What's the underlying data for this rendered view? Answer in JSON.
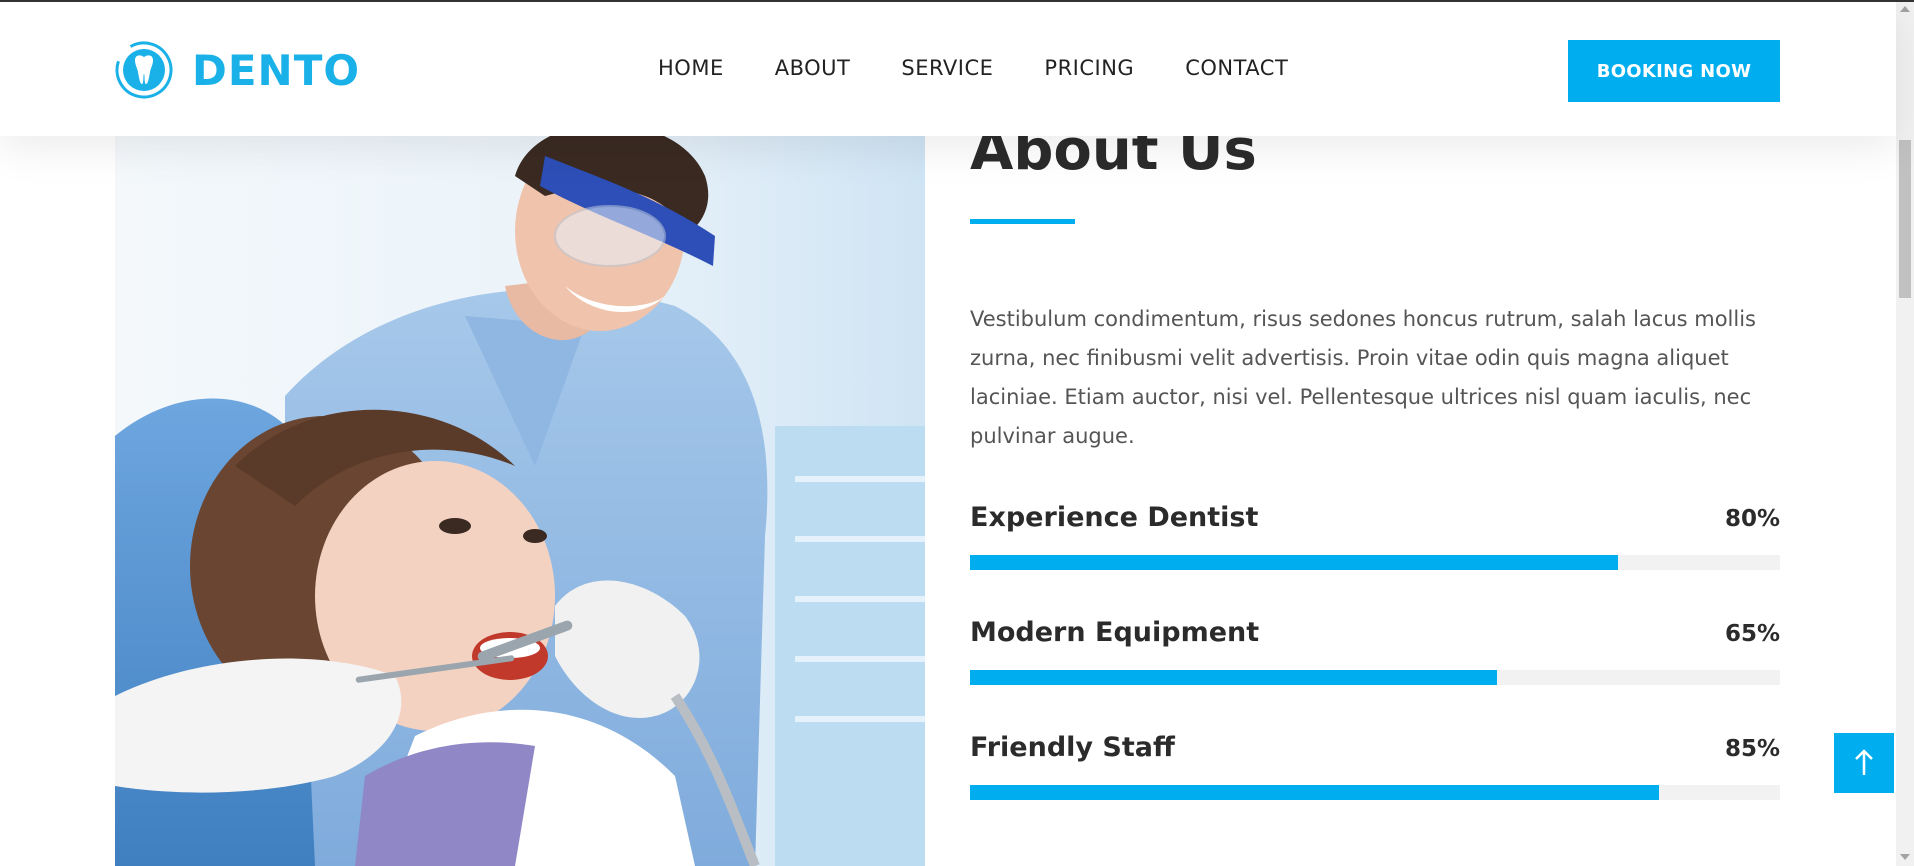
{
  "brand": {
    "name": "DENTO",
    "logo_icon": "tooth-icon",
    "accent_color": "#00aeef"
  },
  "nav": {
    "items": [
      {
        "label": "HOME"
      },
      {
        "label": "ABOUT"
      },
      {
        "label": "SERVICE"
      },
      {
        "label": "PRICING"
      },
      {
        "label": "CONTACT"
      }
    ],
    "booking_label": "BOOKING NOW"
  },
  "about": {
    "title": "About Us",
    "body": "Vestibulum condimentum, risus sedones honcus rutrum, salah lacus mollis zurna, nec finibusmi velit advertisis. Proin vitae odin quis magna aliquet laciniae. Etiam auctor, nisi vel. Pellentesque ultrices nisl quam iaculis, nec pulvinar augue.",
    "image_icon": "dentist-photo",
    "skills": [
      {
        "name": "Experience Dentist",
        "percent_label": "80%",
        "percent": 80
      },
      {
        "name": "Modern Equipment",
        "percent_label": "65%",
        "percent": 65
      },
      {
        "name": "Friendly Staff",
        "percent_label": "85%",
        "percent": 85
      }
    ]
  },
  "back_to_top": {
    "icon": "arrow-up-icon"
  }
}
